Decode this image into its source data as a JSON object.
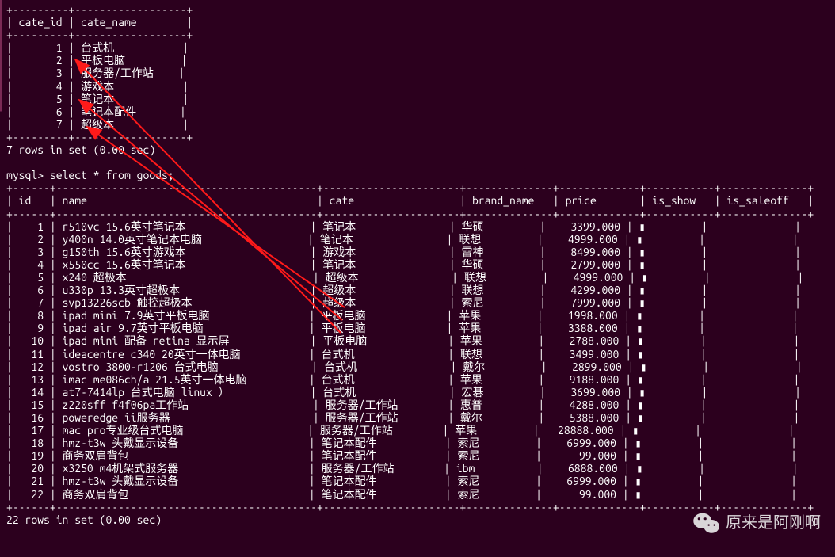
{
  "cate_table": {
    "headers": [
      "cate_id",
      "cate_name"
    ],
    "rows": [
      {
        "cate_id": "1",
        "cate_name": "台式机"
      },
      {
        "cate_id": "2",
        "cate_name": "平板电脑"
      },
      {
        "cate_id": "3",
        "cate_name": "服务器/工作站"
      },
      {
        "cate_id": "4",
        "cate_name": "游戏本"
      },
      {
        "cate_id": "5",
        "cate_name": "笔记本"
      },
      {
        "cate_id": "6",
        "cate_name": "笔记本配件"
      },
      {
        "cate_id": "7",
        "cate_name": "超级本"
      }
    ],
    "footer": "7 rows in set (0.00 sec)"
  },
  "prompt": "mysql> ",
  "query": "select * from goods;",
  "goods_table": {
    "headers": [
      "id",
      "name",
      "cate",
      "brand_name",
      "price",
      "is_show",
      "is_saleoff"
    ],
    "rows": [
      {
        "id": "1",
        "name": "r510vc 15.6英寸笔记本",
        "cate": "笔记本",
        "brand_name": "华硕",
        "price": "3399.000",
        "is_show": "▮",
        "is_saleoff": ""
      },
      {
        "id": "2",
        "name": "y400n 14.0英寸笔记本电脑",
        "cate": "笔记本",
        "brand_name": "联想",
        "price": "4999.000",
        "is_show": "▮",
        "is_saleoff": ""
      },
      {
        "id": "3",
        "name": "g150th 15.6英寸游戏本",
        "cate": "游戏本",
        "brand_name": "雷神",
        "price": "8499.000",
        "is_show": "▮",
        "is_saleoff": ""
      },
      {
        "id": "4",
        "name": "x550cc 15.6英寸笔记本",
        "cate": "笔记本",
        "brand_name": "华硕",
        "price": "2799.000",
        "is_show": "▮",
        "is_saleoff": ""
      },
      {
        "id": "5",
        "name": "x240 超极本",
        "cate": "超级本",
        "brand_name": "联想",
        "price": "4999.000",
        "is_show": "▮",
        "is_saleoff": ""
      },
      {
        "id": "6",
        "name": "u330p 13.3英寸超极本",
        "cate": "超级本",
        "brand_name": "联想",
        "price": "4299.000",
        "is_show": "▮",
        "is_saleoff": ""
      },
      {
        "id": "7",
        "name": "svp13226scb 触控超极本",
        "cate": "超级本",
        "brand_name": "索尼",
        "price": "7999.000",
        "is_show": "▮",
        "is_saleoff": ""
      },
      {
        "id": "8",
        "name": "ipad mini 7.9英寸平板电脑",
        "cate": "平板电脑",
        "brand_name": "苹果",
        "price": "1998.000",
        "is_show": "▮",
        "is_saleoff": ""
      },
      {
        "id": "9",
        "name": "ipad air 9.7英寸平板电脑",
        "cate": "平板电脑",
        "brand_name": "苹果",
        "price": "3388.000",
        "is_show": "▮",
        "is_saleoff": ""
      },
      {
        "id": "10",
        "name": "ipad mini 配备 retina 显示屏",
        "cate": "平板电脑",
        "brand_name": "苹果",
        "price": "2788.000",
        "is_show": "▮",
        "is_saleoff": ""
      },
      {
        "id": "11",
        "name": "ideacentre c340 20英寸一体电脑",
        "cate": "台式机",
        "brand_name": "联想",
        "price": "3499.000",
        "is_show": "▮",
        "is_saleoff": ""
      },
      {
        "id": "12",
        "name": "vostro 3800-r1206 台式电脑",
        "cate": "台式机",
        "brand_name": "戴尔",
        "price": "2899.000",
        "is_show": "▮",
        "is_saleoff": ""
      },
      {
        "id": "13",
        "name": "imac me086ch/a 21.5英寸一体电脑",
        "cate": "台式机",
        "brand_name": "苹果",
        "price": "9188.000",
        "is_show": "▮",
        "is_saleoff": ""
      },
      {
        "id": "14",
        "name": "at7-7414lp 台式电脑 linux ）",
        "cate": "台式机",
        "brand_name": "宏碁",
        "price": "3699.000",
        "is_show": "▮",
        "is_saleoff": ""
      },
      {
        "id": "15",
        "name": "z220sff f4f06pa工作站",
        "cate": "服务器/工作站",
        "brand_name": "惠普",
        "price": "4288.000",
        "is_show": "▮",
        "is_saleoff": ""
      },
      {
        "id": "16",
        "name": "poweredge ii服务器",
        "cate": "服务器/工作站",
        "brand_name": "戴尔",
        "price": "5388.000",
        "is_show": "▮",
        "is_saleoff": ""
      },
      {
        "id": "17",
        "name": "mac pro专业级台式电脑",
        "cate": "服务器/工作站",
        "brand_name": "苹果",
        "price": "28888.000",
        "is_show": "▮",
        "is_saleoff": ""
      },
      {
        "id": "18",
        "name": "hmz-t3w 头戴显示设备",
        "cate": "笔记本配件",
        "brand_name": "索尼",
        "price": "6999.000",
        "is_show": "▮",
        "is_saleoff": ""
      },
      {
        "id": "19",
        "name": "商务双肩背包",
        "cate": "笔记本配件",
        "brand_name": "索尼",
        "price": "99.000",
        "is_show": "▮",
        "is_saleoff": ""
      },
      {
        "id": "20",
        "name": "x3250 m4机架式服务器",
        "cate": "服务器/工作站",
        "brand_name": "ibm",
        "price": "6888.000",
        "is_show": "▮",
        "is_saleoff": ""
      },
      {
        "id": "21",
        "name": "hmz-t3w 头戴显示设备",
        "cate": "笔记本配件",
        "brand_name": "索尼",
        "price": "6999.000",
        "is_show": "▮",
        "is_saleoff": ""
      },
      {
        "id": "22",
        "name": "商务双肩背包",
        "cate": "笔记本配件",
        "brand_name": "索尼",
        "price": "99.000",
        "is_show": "▮",
        "is_saleoff": ""
      }
    ],
    "footer": "22 rows in set (0.00 sec)"
  },
  "watermark": "原来是阿刚啊"
}
